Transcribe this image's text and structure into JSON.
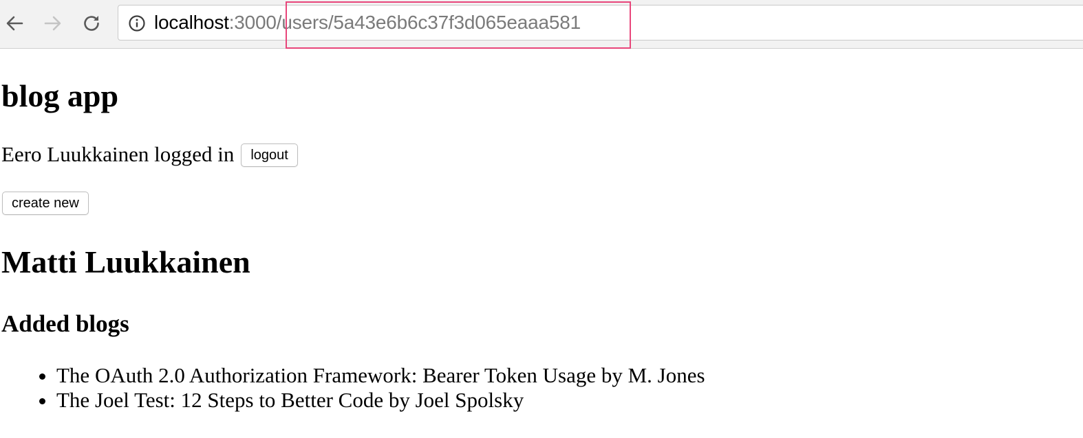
{
  "browser": {
    "url": {
      "host": "localhost",
      "port": ":3000",
      "path": "/users/5a43e6b6c37f3d065eaaa581"
    },
    "highlight_color": "#e8457a",
    "icons": {
      "back": "arrow-left-icon",
      "forward": "arrow-right-icon",
      "reload": "reload-icon",
      "site_info": "info-circle-icon"
    }
  },
  "page": {
    "app_title": "blog app",
    "login_status": "Eero Luukkainen logged in",
    "logout_label": "logout",
    "create_label": "create new",
    "user_name": "Matti Luukkainen",
    "blogs_heading": "Added blogs",
    "blogs": [
      "The OAuth 2.0 Authorization Framework: Bearer Token Usage by M. Jones",
      "The Joel Test: 12 Steps to Better Code by Joel Spolsky"
    ]
  }
}
